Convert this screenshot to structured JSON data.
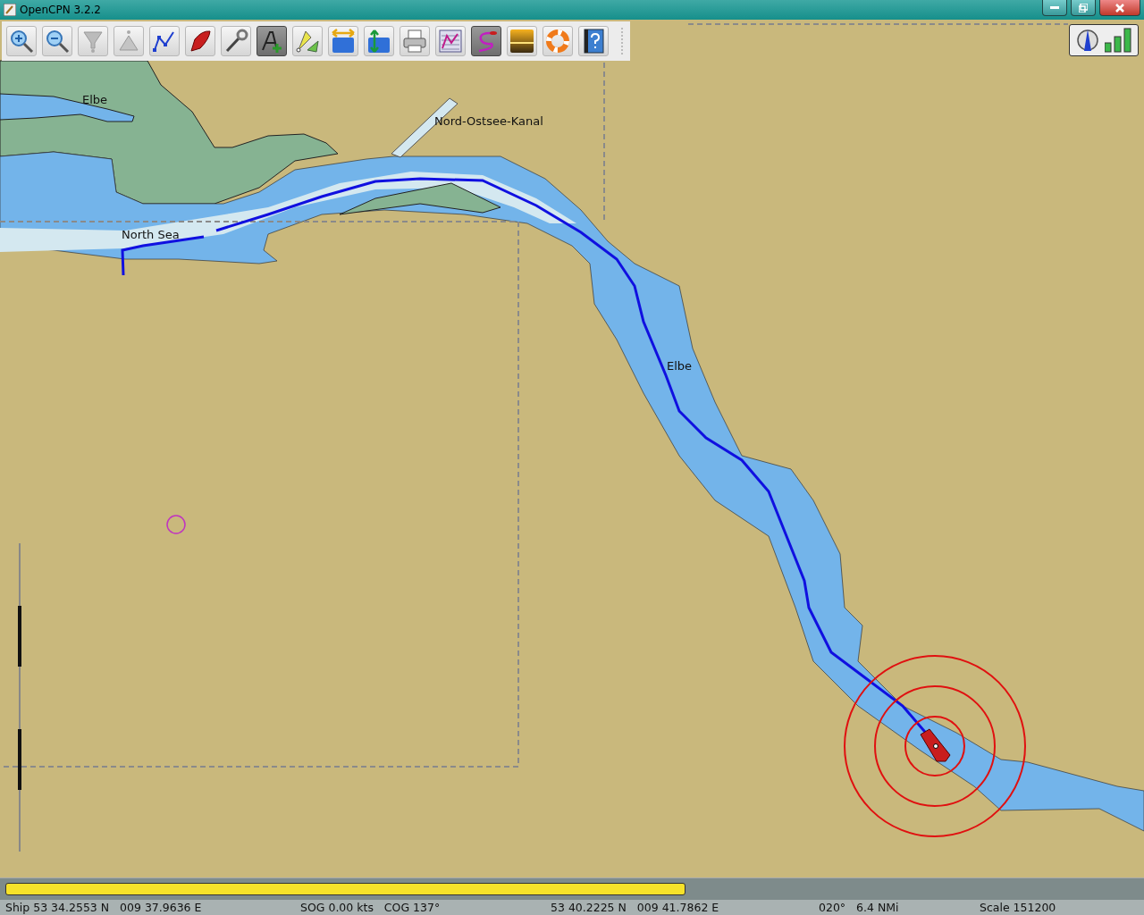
{
  "window": {
    "title": "OpenCPN 3.2.2"
  },
  "tools": [
    {
      "kind": "zoomin",
      "selected": false
    },
    {
      "kind": "zoomout",
      "selected": false
    },
    {
      "kind": "scaledown",
      "selected": false
    },
    {
      "kind": "scaleup",
      "selected": false
    },
    {
      "kind": "route",
      "selected": false
    },
    {
      "kind": "ship",
      "selected": false
    },
    {
      "kind": "settings",
      "selected": false
    },
    {
      "kind": "text",
      "selected": true
    },
    {
      "kind": "marks",
      "selected": false
    },
    {
      "kind": "currents",
      "selected": false
    },
    {
      "kind": "tides",
      "selected": false
    },
    {
      "kind": "print",
      "selected": false
    },
    {
      "kind": "manager",
      "selected": false
    },
    {
      "kind": "track",
      "selected": true
    },
    {
      "kind": "sunset",
      "selected": false
    },
    {
      "kind": "lifebuoy",
      "selected": false
    },
    {
      "kind": "help",
      "selected": false
    }
  ],
  "chart": {
    "labels": [
      {
        "text": "Elbe"
      },
      {
        "text": "Nord-Ostsee-Kanal"
      },
      {
        "text": "North Sea"
      },
      {
        "text": "Elbe"
      }
    ]
  },
  "progress": {
    "level": 0.6
  },
  "status_bar": [
    "Ship 53 34.2553 N   009 37.9636 E",
    "SOG 0.00 kts   COG 137°",
    "53 40.2225 N   009 41.7862 E",
    "020°   6.4 NMi",
    "Scale 151200"
  ]
}
